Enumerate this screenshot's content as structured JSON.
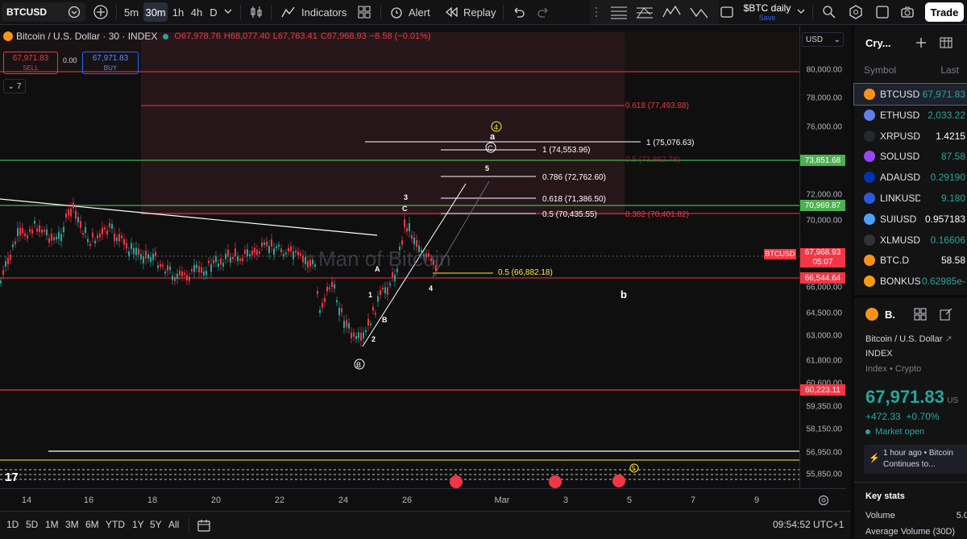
{
  "toolbar": {
    "symbol": "BTCUSD",
    "timeframes": [
      "5m",
      "30m",
      "1h",
      "4h",
      "D"
    ],
    "active_timeframe": "30m",
    "indicators_label": "Indicators",
    "alert_label": "Alert",
    "replay_label": "Replay",
    "layout_name": "$BTC daily",
    "layout_status": "Save",
    "trade_label": "Trade"
  },
  "legend": {
    "title": "Bitcoin / U.S. Dollar · 30 · INDEX",
    "open": "O67,978.76",
    "high": "H68,077.40",
    "low": "L67,763.41",
    "close": "C67,968.93",
    "change": "−8.58 (−0.01%)"
  },
  "order": {
    "sell_price": "67,971.83",
    "sell_label": "SELL",
    "spread": "0.00",
    "buy_price": "67,971.83",
    "buy_label": "BUY",
    "indicator_count": "7"
  },
  "watermark": "Man of Bitcoin",
  "chart": {
    "currency": "USD",
    "price_ticks": [
      "80,000.00",
      "78,000.00",
      "76,000.00",
      "72,000.00",
      "70,000.00",
      "66,000.00",
      "64,500.00",
      "63,000.00",
      "61,800.00",
      "60,600.00",
      "59,350.00",
      "58,150.00",
      "56,950.00",
      "55,850.00"
    ],
    "horizontal_levels": [
      {
        "label": "73,851.68",
        "color": "#4caf50"
      },
      {
        "label": "70,969.87",
        "color": "#4caf50"
      },
      {
        "label": "66,544.64",
        "color": "#f23645"
      },
      {
        "label": "60,223.11",
        "color": "#f23645"
      }
    ],
    "current_price": {
      "label": "67,968.93",
      "countdown": "05:07",
      "tag": "BTCUSD"
    },
    "fib_labels": [
      "0.618 (77,493.88)",
      "1 (75,076.63)",
      "1 (74,553.96)",
      "0.5 (73,862.78)",
      "0.786 (72,762.60)",
      "0.618 (71,386.50)",
      "0.5 (70,435.55)",
      "0.382 (70,401.82)",
      "0.5 (66,882.18)"
    ],
    "wave_labels": [
      "a",
      "4",
      "C",
      "5",
      "3",
      "C",
      "A",
      "1",
      "B",
      "2",
      "4",
      "B",
      "b",
      "5"
    ],
    "x_ticks": [
      "14",
      "16",
      "18",
      "20",
      "22",
      "24",
      "26",
      "Mar",
      "3",
      "5",
      "7",
      "9"
    ]
  },
  "bottom": {
    "ranges": [
      "1D",
      "5D",
      "1M",
      "3M",
      "6M",
      "YTD",
      "1Y",
      "5Y",
      "All"
    ],
    "time": "09:54:52 UTC+1"
  },
  "watchlist": {
    "title": "Cry...",
    "col_symbol": "Symbol",
    "col_last": "Last",
    "items": [
      {
        "sym": "BTCUSD",
        "last": "67,971.83",
        "color": "#26a69a",
        "icon": "#f7931a"
      },
      {
        "sym": "ETHUSD",
        "last": "2,033.22",
        "color": "#26a69a",
        "icon": "#627eea"
      },
      {
        "sym": "XRPUSD",
        "last": "1.4215",
        "color": "#ffffff",
        "icon": "#23292f"
      },
      {
        "sym": "SOLUSD",
        "last": "87.58",
        "color": "#26a69a",
        "icon": "#9945ff"
      },
      {
        "sym": "ADAUSD",
        "last": "0.29190",
        "color": "#26a69a",
        "icon": "#0033ad"
      },
      {
        "sym": "LINKUSD",
        "last": "9.180",
        "color": "#26a69a",
        "icon": "#2a5ada"
      },
      {
        "sym": "SUIUSD",
        "last": "0.957183",
        "color": "#ffffff",
        "icon": "#4da2ff"
      },
      {
        "sym": "XLMUSD",
        "last": "0.16606",
        "color": "#26a69a",
        "icon": "#333333"
      },
      {
        "sym": "BTC.D",
        "last": "58.58",
        "color": "#ffffff",
        "icon": "#f7931a"
      },
      {
        "sym": "BONKUS",
        "last": "0.62985e-",
        "color": "#26a69a",
        "icon": "#f59e0b"
      }
    ]
  },
  "details": {
    "short": "B.",
    "name": "Bitcoin / U.S. Dollar",
    "exchange": "INDEX",
    "type": "Index • Crypto",
    "price": "67,971.83",
    "currency": "US",
    "change": "+472.33",
    "change_pct": "+0.70%",
    "market_status": "Market open",
    "news_time": "1 hour ago • Bitcoin",
    "news_text": "Continues to...",
    "key_stats": "Key stats",
    "volume_label": "Volume",
    "volume_value": "5.0",
    "avg_volume_label": "Average Volume (30D)"
  }
}
